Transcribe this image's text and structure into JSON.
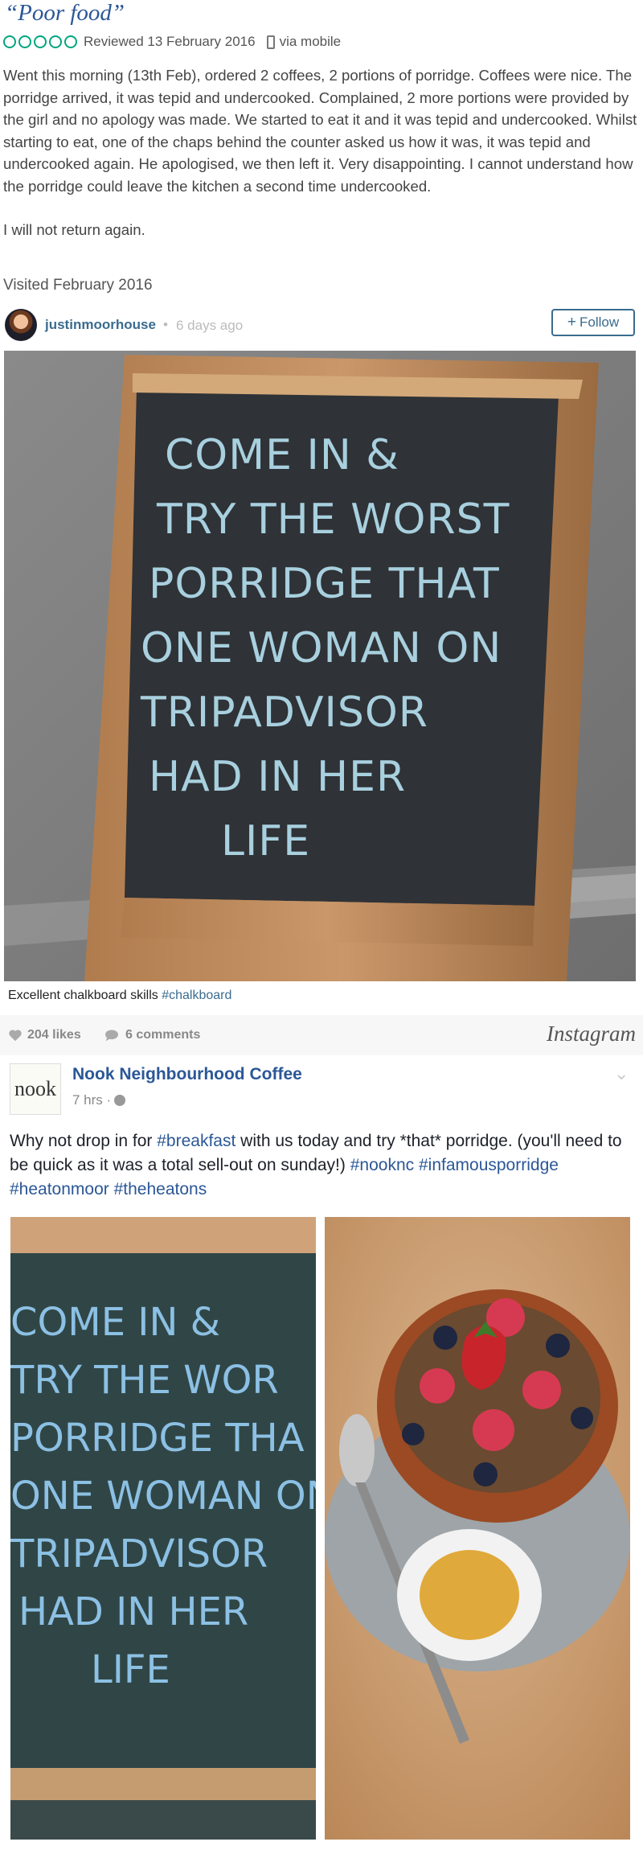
{
  "review": {
    "title": "“Poor food”",
    "reviewed_text": "Reviewed 13 February 2016",
    "via_text": "via mobile",
    "rating_bubbles": 0,
    "accent_color": "#00a680",
    "paragraphs": [
      "Went this morning (13th Feb), ordered 2 coffees, 2 portions of porridge. Coffees were nice. The porridge arrived, it was tepid and undercooked. Complained, 2 more portions were provided by the girl and no apology was made. We started to eat it and it was tepid and undercooked. Whilst starting to eat, one of the chaps behind the counter asked us how it was, it was tepid and undercooked again. He apologised, we then left it. Very disappointing. I cannot understand how the porridge could leave the kitchen a second time undercooked.",
      "I will not return again."
    ],
    "visited": "Visited February 2016"
  },
  "instagram": {
    "username": "justinmoorhouse",
    "separator": "•",
    "time_ago": "6 days ago",
    "follow_label": "Follow",
    "follow_icon": "plus-icon",
    "board_lines": [
      "COME IN &",
      "TRY THE WORST",
      "PORRIDGE THAT",
      "ONE WOMAN ON",
      "TRIPADVISOR",
      "HAD IN HER",
      "LIFE"
    ],
    "caption_text": "Excellent chalkboard skills",
    "caption_tag": "#chalkboard",
    "likes": "204 likes",
    "comments": "6 comments",
    "logo_text": "Instagram",
    "link_color": "#3a6c8f"
  },
  "facebook": {
    "page_logo_text": "nook",
    "page_name": "Nook Neighbourhood Coffee",
    "time": "7 hrs ·",
    "audience_icon": "globe-icon",
    "menu_icon": "chevron-down-icon",
    "text_1": "Why not drop in for ",
    "tag_breakfast": "#breakfast",
    "text_2": " with us today and try *that* porridge. (you'll need to be quick as it was a total sell-out on sunday!) ",
    "tag_nooknc": "#nooknc",
    "tag_infamous": "#infamousporridge",
    "tag_heatonmoor": "#heatonmoor",
    "tag_theheatons": "#theheatons",
    "board_lines": [
      "COME IN &",
      "TRY THE WOR",
      "PORRIDGE THA",
      "ONE WOMAN ON",
      "TRIPADVISOR",
      "HAD IN HER",
      "LIFE"
    ],
    "link_color": "#2b5797"
  }
}
